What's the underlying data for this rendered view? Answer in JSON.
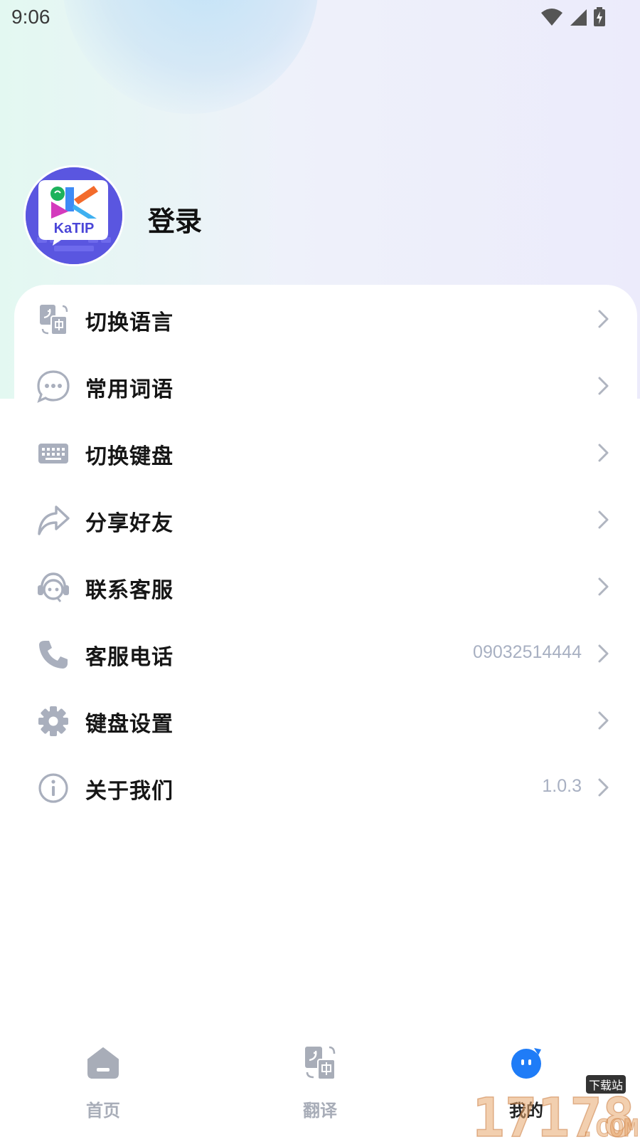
{
  "status_bar": {
    "time": "9:06"
  },
  "profile": {
    "login_label": "登录",
    "logo_text": "KaTIP"
  },
  "menu": [
    {
      "label": "切换语言",
      "icon": "translate-icon",
      "value": ""
    },
    {
      "label": "常用词语",
      "icon": "chat-bubble-icon",
      "value": ""
    },
    {
      "label": "切换键盘",
      "icon": "keyboard-icon",
      "value": ""
    },
    {
      "label": "分享好友",
      "icon": "share-icon",
      "value": ""
    },
    {
      "label": "联系客服",
      "icon": "headset-icon",
      "value": ""
    },
    {
      "label": "客服电话",
      "icon": "phone-icon",
      "value": "09032514444"
    },
    {
      "label": "键盘设置",
      "icon": "gear-icon",
      "value": ""
    },
    {
      "label": "关于我们",
      "icon": "info-icon",
      "value": "1.0.3"
    }
  ],
  "tabs": [
    {
      "label": "首页",
      "icon": "home-icon",
      "active": false
    },
    {
      "label": "翻译",
      "icon": "translate-icon",
      "active": false
    },
    {
      "label": "我的",
      "icon": "profile-face-icon",
      "active": true
    }
  ],
  "watermark": {
    "text": "17178",
    "sub": "下载站",
    "domain": ".COM"
  },
  "colors": {
    "accent": "#1f7cf7",
    "icon_gray": "#a9afbd",
    "value_gray": "#a8b0c2",
    "avatar_bg": "#5a56e0"
  }
}
